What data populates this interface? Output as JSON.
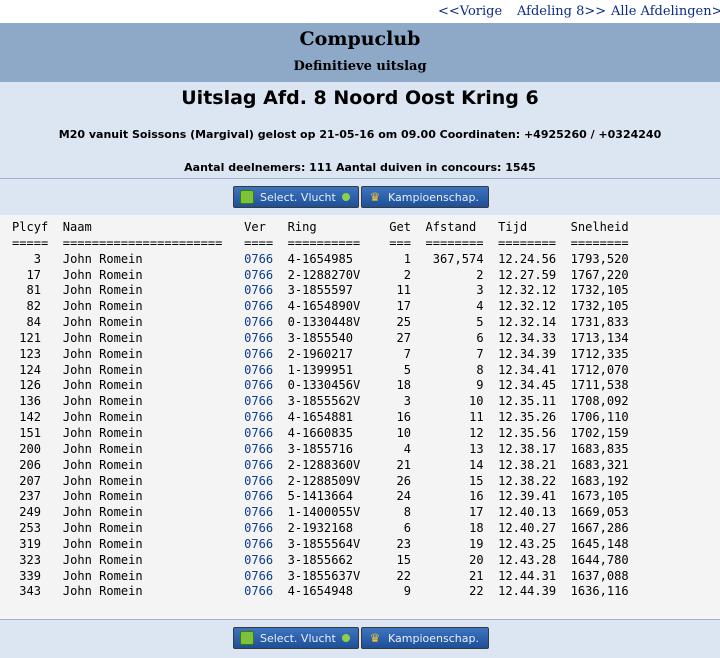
{
  "nav": {
    "prev": "<<Vorige",
    "next": "Afdeling 8>>",
    "all": "Alle Afdelingen>>"
  },
  "header": {
    "club": "Compuclub",
    "subtitle": "Definitieve uitslag",
    "title": "Uitslag Afd. 8 Noord Oost Kring 6",
    "line1": "M20 vanuit Soissons (Margival) gelost op 21-05-16 om 09.00 Coordinaten: +4925260 / +0324240",
    "line2": "Aantal deelnemers: 111 Aantal duiven in concours: 1545"
  },
  "buttons": {
    "select": "Select. Vlucht",
    "kampioen": "Kampioenschap."
  },
  "icons": {
    "select_left": "list-icon",
    "select_right": "arrow-icon",
    "kampioen": "crown-icon"
  },
  "table": {
    "headers": [
      "Plcyf",
      "Naam",
      "Ver",
      "Ring",
      "Get",
      "Afstand",
      "Tijd",
      "Snelheid"
    ],
    "underlines": [
      "=====",
      "======================",
      "====",
      "==========",
      "===",
      "========",
      "========",
      "========"
    ],
    "rows": [
      [
        "3",
        "John Romein",
        "0766",
        "4-1654985",
        "1",
        "367,574",
        "12.24.56",
        "1793,520"
      ],
      [
        "17",
        "John Romein",
        "0766",
        "2-1288270V",
        "2",
        "2",
        "12.27.59",
        "1767,220"
      ],
      [
        "81",
        "John Romein",
        "0766",
        "3-1855597",
        "11",
        "3",
        "12.32.12",
        "1732,105"
      ],
      [
        "82",
        "John Romein",
        "0766",
        "4-1654890V",
        "17",
        "4",
        "12.32.12",
        "1732,105"
      ],
      [
        "84",
        "John Romein",
        "0766",
        "0-1330448V",
        "25",
        "5",
        "12.32.14",
        "1731,833"
      ],
      [
        "121",
        "John Romein",
        "0766",
        "3-1855540",
        "27",
        "6",
        "12.34.33",
        "1713,134"
      ],
      [
        "123",
        "John Romein",
        "0766",
        "2-1960217",
        "7",
        "7",
        "12.34.39",
        "1712,335"
      ],
      [
        "124",
        "John Romein",
        "0766",
        "1-1399951",
        "5",
        "8",
        "12.34.41",
        "1712,070"
      ],
      [
        "126",
        "John Romein",
        "0766",
        "0-1330456V",
        "18",
        "9",
        "12.34.45",
        "1711,538"
      ],
      [
        "136",
        "John Romein",
        "0766",
        "3-1855562V",
        "3",
        "10",
        "12.35.11",
        "1708,092"
      ],
      [
        "142",
        "John Romein",
        "0766",
        "4-1654881",
        "16",
        "11",
        "12.35.26",
        "1706,110"
      ],
      [
        "151",
        "John Romein",
        "0766",
        "4-1660835",
        "10",
        "12",
        "12.35.56",
        "1702,159"
      ],
      [
        "200",
        "John Romein",
        "0766",
        "3-1855716",
        "4",
        "13",
        "12.38.17",
        "1683,835"
      ],
      [
        "206",
        "John Romein",
        "0766",
        "2-1288360V",
        "21",
        "14",
        "12.38.21",
        "1683,321"
      ],
      [
        "207",
        "John Romein",
        "0766",
        "2-1288509V",
        "26",
        "15",
        "12.38.22",
        "1683,192"
      ],
      [
        "237",
        "John Romein",
        "0766",
        "5-1413664",
        "24",
        "16",
        "12.39.41",
        "1673,105"
      ],
      [
        "249",
        "John Romein",
        "0766",
        "1-1400055V",
        "8",
        "17",
        "12.40.13",
        "1669,053"
      ],
      [
        "253",
        "John Romein",
        "0766",
        "2-1932168",
        "6",
        "18",
        "12.40.27",
        "1667,286"
      ],
      [
        "319",
        "John Romein",
        "0766",
        "3-1855564V",
        "23",
        "19",
        "12.43.25",
        "1645,148"
      ],
      [
        "323",
        "John Romein",
        "0766",
        "3-1855662",
        "15",
        "20",
        "12.43.28",
        "1644,780"
      ],
      [
        "339",
        "John Romein",
        "0766",
        "3-1855637V",
        "22",
        "21",
        "12.44.31",
        "1637,088"
      ],
      [
        "343",
        "John Romein",
        "0766",
        "4-1654948",
        "9",
        "22",
        "12.44.39",
        "1636,116"
      ]
    ]
  }
}
